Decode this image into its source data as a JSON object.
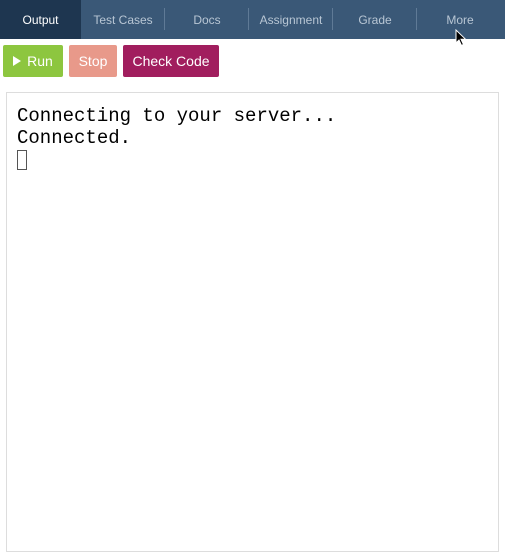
{
  "tabs": [
    {
      "label": "Output",
      "active": true
    },
    {
      "label": "Test Cases",
      "active": false
    },
    {
      "label": "Docs",
      "active": false
    },
    {
      "label": "Assignment",
      "active": false
    },
    {
      "label": "Grade",
      "active": false
    },
    {
      "label": "More",
      "active": false
    }
  ],
  "toolbar": {
    "run_label": "Run",
    "stop_label": "Stop",
    "check_label": "Check Code"
  },
  "console": {
    "lines": [
      "Connecting to your server...",
      "Connected."
    ]
  },
  "colors": {
    "tabbar": "#3a5877",
    "tab_active": "#1e3650",
    "run": "#8dc63f",
    "stop": "#e8998a",
    "check": "#a11e5e"
  },
  "icons": {
    "run": "play-icon",
    "pointer": "mouse-pointer-icon"
  }
}
